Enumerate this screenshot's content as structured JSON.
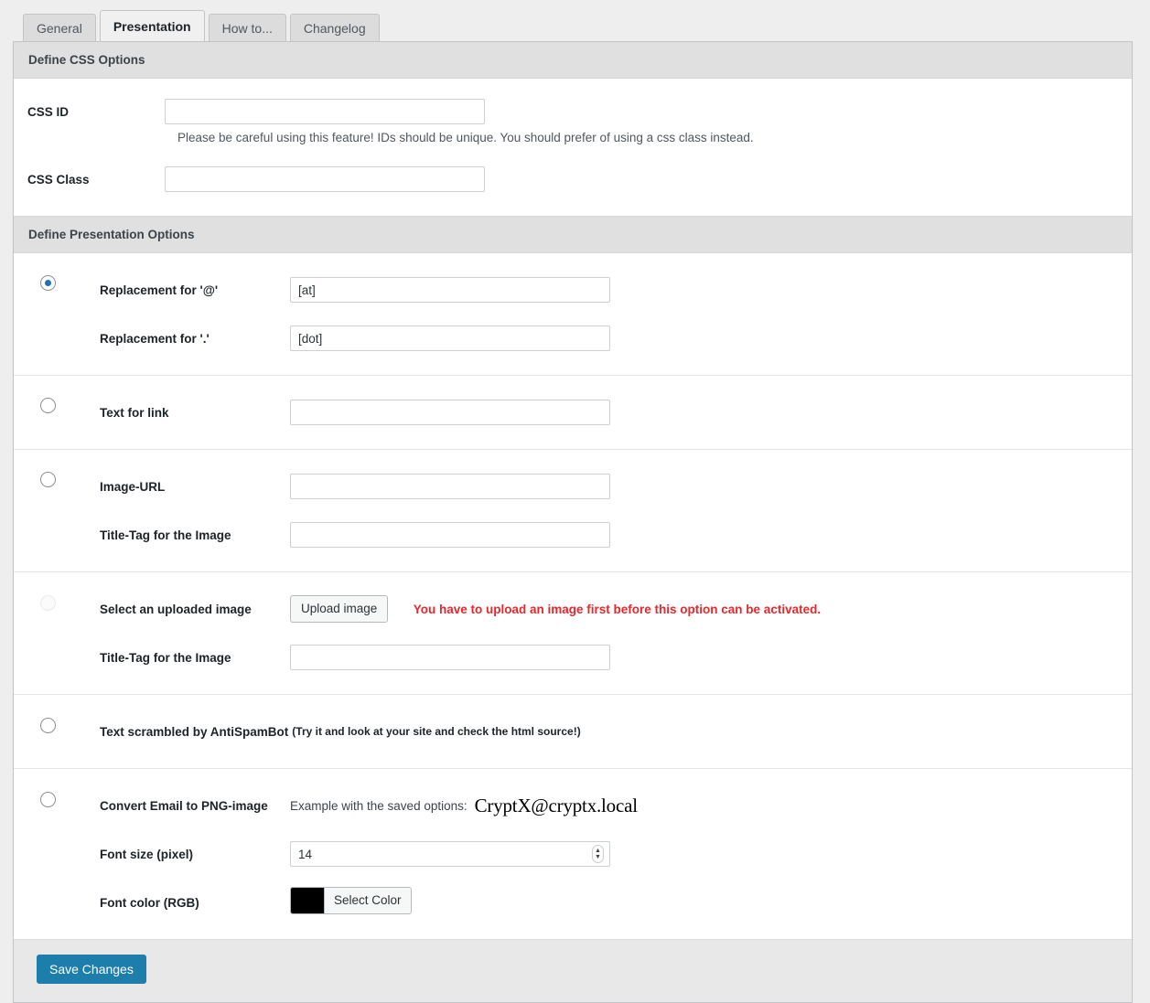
{
  "tabs": [
    {
      "label": "General",
      "active": false
    },
    {
      "label": "Presentation",
      "active": true
    },
    {
      "label": "How to...",
      "active": false
    },
    {
      "label": "Changelog",
      "active": false
    }
  ],
  "css_section": {
    "title": "Define CSS Options",
    "css_id": {
      "label": "CSS ID",
      "value": "",
      "help": "Please be careful using this feature! IDs should be unique. You should prefer of using a css class instead."
    },
    "css_class": {
      "label": "CSS Class",
      "value": ""
    }
  },
  "presentation_section": {
    "title": "Define Presentation Options",
    "options": [
      {
        "id": "replacement",
        "selected": true,
        "fields": [
          {
            "label": "Replacement for '@'",
            "value": "[at]"
          },
          {
            "label": "Replacement for '.'",
            "value": "[dot]"
          }
        ]
      },
      {
        "id": "text-link",
        "selected": false,
        "fields": [
          {
            "label": "Text for link",
            "value": ""
          }
        ]
      },
      {
        "id": "image-url",
        "selected": false,
        "fields": [
          {
            "label": "Image-URL",
            "value": ""
          },
          {
            "label": "Title-Tag for the Image",
            "value": ""
          }
        ]
      },
      {
        "id": "uploaded-image",
        "selected": false,
        "disabled": true,
        "label": "Select an uploaded image",
        "upload_button": "Upload image",
        "warning": "You have to upload an image first before this option can be activated.",
        "title_tag": {
          "label": "Title-Tag for the Image",
          "value": ""
        }
      },
      {
        "id": "antispambot",
        "selected": false,
        "label": "Text scrambled by AntiSpamBot",
        "note": "(Try it and look at your site and check the html source!)"
      },
      {
        "id": "png-image",
        "selected": false,
        "label": "Convert Email to PNG-image",
        "example_label": "Example with the saved options:",
        "example_email": "CryptX@cryptx.local",
        "font_size": {
          "label": "Font size (pixel)",
          "value": "14"
        },
        "font_color": {
          "label": "Font color (RGB)",
          "button": "Select Color",
          "swatch": "#000000"
        }
      }
    ]
  },
  "footer": {
    "save_label": "Save Changes",
    "accent": "#1d7eab"
  }
}
